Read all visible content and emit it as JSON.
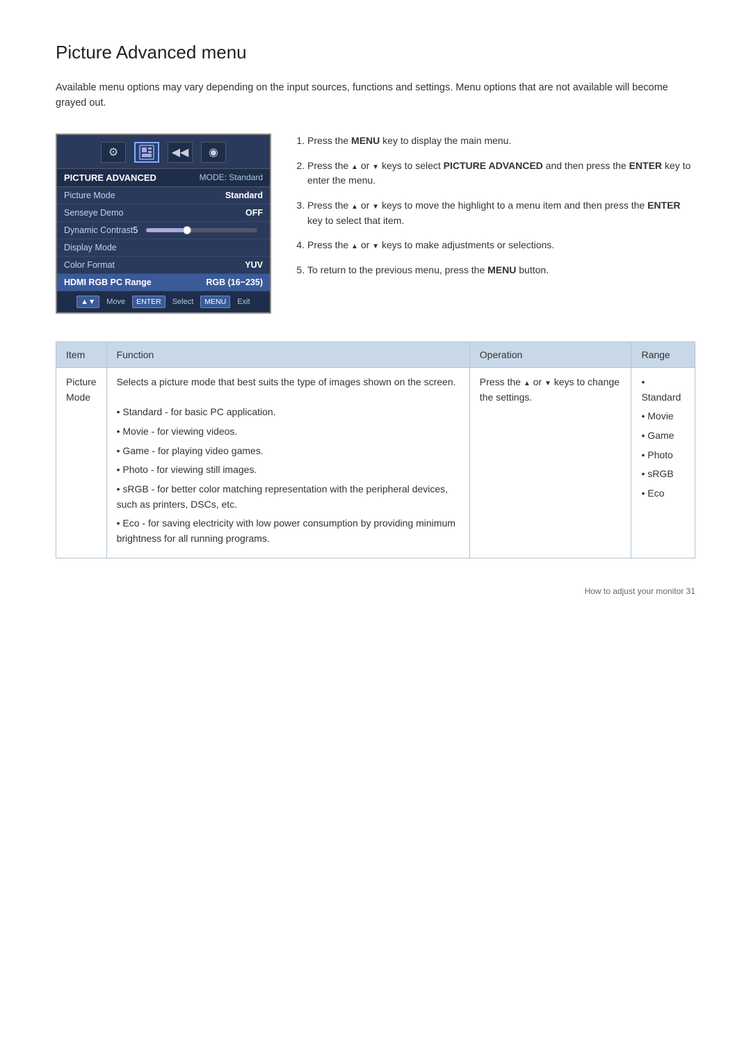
{
  "page": {
    "title": "Picture Advanced menu",
    "intro": "Available menu options may vary depending on the input sources, functions and settings. Menu options that are not available will become grayed out.",
    "footer": "How to adjust your monitor    31"
  },
  "osd": {
    "header_title": "PICTURE ADVANCED",
    "header_mode": "MODE: Standard",
    "icons": [
      "⚙",
      "▣",
      "▤",
      "◀◀",
      "◉"
    ],
    "rows": [
      {
        "label": "Picture Mode",
        "value": "Standard",
        "highlighted": false
      },
      {
        "label": "Senseye Demo",
        "value": "OFF",
        "highlighted": false
      },
      {
        "label": "Dynamic Contrast",
        "value": "5",
        "is_slider": true,
        "highlighted": false
      },
      {
        "label": "Display Mode",
        "value": "",
        "highlighted": false
      },
      {
        "label": "Color Format",
        "value": "YUV",
        "highlighted": false
      },
      {
        "label": "HDMI RGB PC Range",
        "value": "RGB (16~235)",
        "highlighted": true
      }
    ],
    "footer_items": [
      {
        "type": "button",
        "label": "▲▼"
      },
      {
        "type": "text",
        "label": "Move"
      },
      {
        "type": "button",
        "label": "ENTER"
      },
      {
        "type": "text",
        "label": "Select"
      },
      {
        "type": "button",
        "label": "MENU"
      },
      {
        "type": "text",
        "label": "Exit"
      }
    ]
  },
  "steps": [
    {
      "id": 1,
      "text": "Press the ",
      "bold_part": "MENU",
      "text2": " key to display the main menu."
    },
    {
      "id": 2,
      "text_parts": [
        "Press the ",
        " or ",
        " keys to select ",
        "PICTURE ADVANCED",
        " and then press the ",
        "ENTER",
        " key to enter the menu."
      ]
    },
    {
      "id": 3,
      "text_parts": [
        "Press the ",
        " or ",
        " keys to move the highlight to a menu item and then press the ",
        "ENTER",
        " key to select that item."
      ]
    },
    {
      "id": 4,
      "text_parts": [
        "Press the ",
        " or ",
        " keys to make adjustments or selections."
      ]
    },
    {
      "id": 5,
      "text_parts": [
        "To return to the previous menu, press the ",
        "MENU",
        " button."
      ]
    }
  ],
  "table": {
    "columns": [
      "Item",
      "Function",
      "Operation",
      "Range"
    ],
    "rows": [
      {
        "item": "Picture\nMode",
        "function_intro": "Selects a picture mode that best suits the type of images shown on the screen.",
        "function_bullets": [
          "Standard - for basic PC application.",
          "Movie - for viewing videos.",
          "Game - for playing video games.",
          "Photo - for viewing still images.",
          "sRGB - for better color matching representation with the peripheral devices, such as printers, DSCs, etc.",
          "Eco - for saving electricity with low power consumption by providing minimum brightness for all running programs."
        ],
        "operation": "Press the ▲ or ▼ keys to change the settings.",
        "range_bullets": [
          "Standard",
          "Movie",
          "Game",
          "Photo",
          "sRGB",
          "Eco"
        ]
      }
    ]
  }
}
